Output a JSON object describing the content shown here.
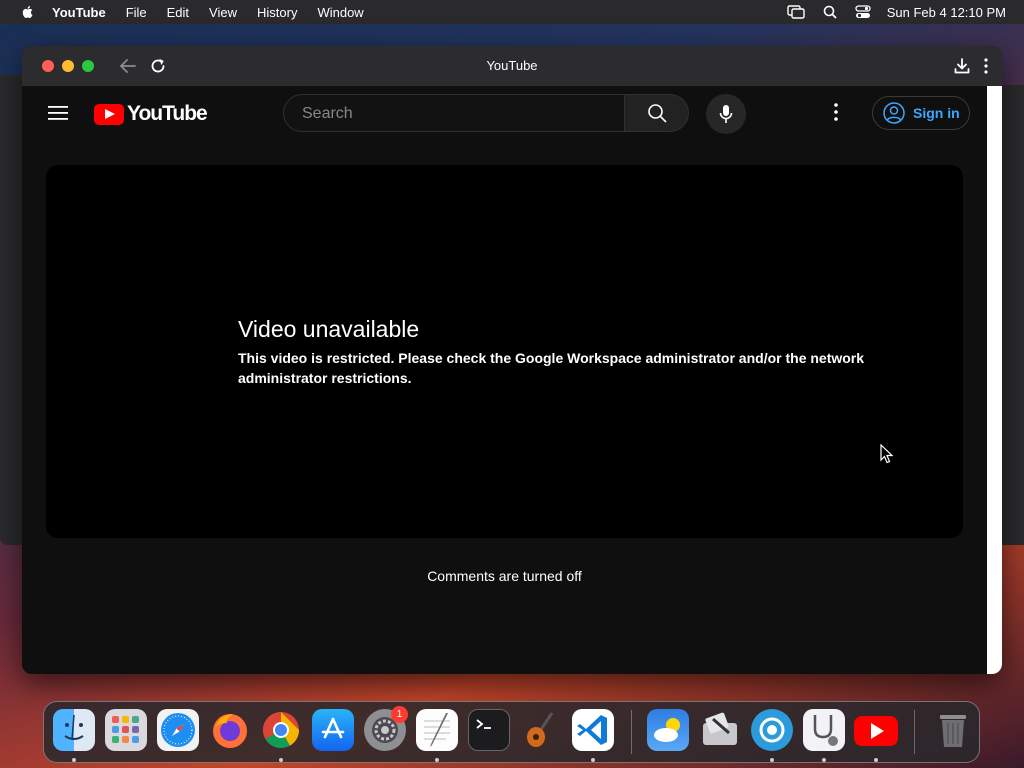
{
  "menubar": {
    "app_name": "YouTube",
    "items": [
      "File",
      "Edit",
      "View",
      "History",
      "Window"
    ],
    "clock": "Sun Feb 4  12:10 PM"
  },
  "window": {
    "title": "YouTube"
  },
  "youtube": {
    "logo_text": "YouTube",
    "search_placeholder": "Search",
    "sign_in_label": "Sign in",
    "error_title": "Video unavailable",
    "error_message": "This video is restricted. Please check the Google Workspace administrator and/or the network administrator restrictions.",
    "comments_status": "Comments are turned off"
  },
  "dock": {
    "apps": [
      "finder-icon",
      "launchpad-icon",
      "safari-icon",
      "firefox-icon",
      "chrome-icon",
      "app-store-icon",
      "system-settings-icon",
      "textedit-icon",
      "terminal-icon",
      "garageband-icon",
      "vscode-icon",
      "weather-icon",
      "disk-utility-icon",
      "network-icon",
      "system-information-icon",
      "youtube-app-icon",
      "trash-icon"
    ],
    "settings_badge": "1"
  },
  "colors": {
    "accent_link": "#3ea6ff",
    "youtube_red": "#ff0000"
  }
}
